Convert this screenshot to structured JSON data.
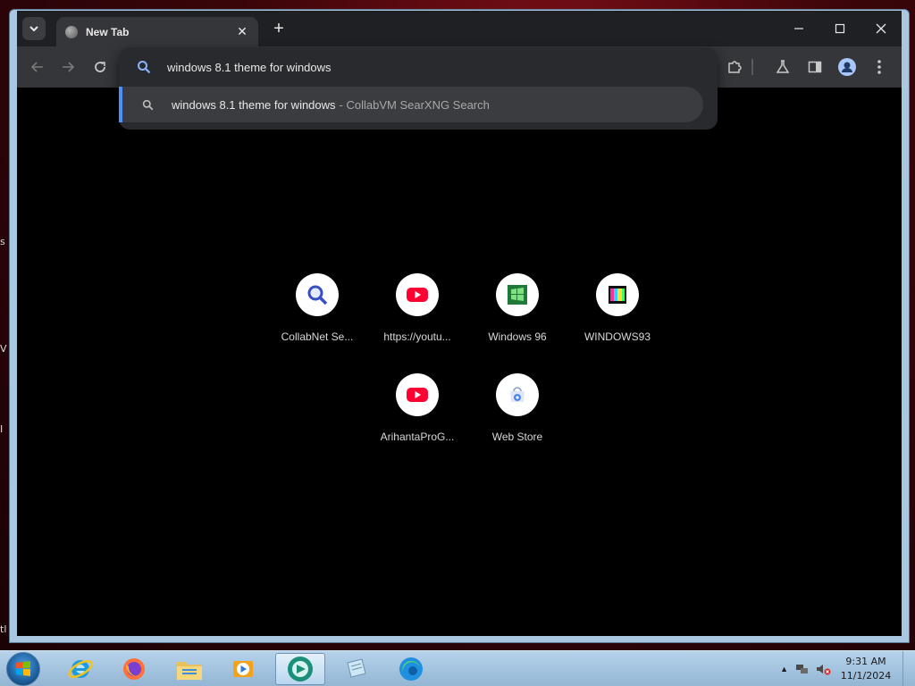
{
  "browser": {
    "tab": {
      "title": "New Tab",
      "close_glyph": "✕"
    },
    "new_tab_glyph": "+",
    "window_controls": {
      "minimize": "—",
      "maximize": "☐",
      "close": "✕"
    },
    "toolbar_icons": [
      "back-icon",
      "forward-icon",
      "reload-icon",
      "extensions-icon",
      "labs-icon",
      "side-panel-icon",
      "profile-icon",
      "menu-icon"
    ]
  },
  "omnibox": {
    "query": "windows 8.1 theme for windows",
    "suggestions": [
      {
        "text": "windows 8.1 theme for windows",
        "source": "- CollabVM SearXNG Search"
      }
    ]
  },
  "shortcuts": [
    {
      "label": "CollabNet Se...",
      "icon": "magnifier-icon"
    },
    {
      "label": "https://youtu...",
      "icon": "youtube-icon"
    },
    {
      "label": "Windows 96",
      "icon": "windows96-icon"
    },
    {
      "label": "WINDOWS93",
      "icon": "windows93-icon"
    },
    {
      "label": "ArihantaProG...",
      "icon": "youtube-icon"
    },
    {
      "label": "Web Store",
      "icon": "webstore-icon"
    }
  ],
  "desktop_edge_text": [
    "s",
    "V",
    "I",
    "tl"
  ],
  "taskbar": {
    "apps": [
      "internet-explorer-icon",
      "firefox-icon",
      "file-explorer-icon",
      "media-player-icon",
      "chrome-like-icon",
      "notepad-icon",
      "edge-icon"
    ],
    "clock": {
      "time": "9:31 AM",
      "date": "11/1/2024"
    }
  },
  "colors": {
    "accent": "#4f8ff7",
    "youtube_red": "#ff0033",
    "tab_bg": "#35363a",
    "page_bg": "#000000"
  }
}
